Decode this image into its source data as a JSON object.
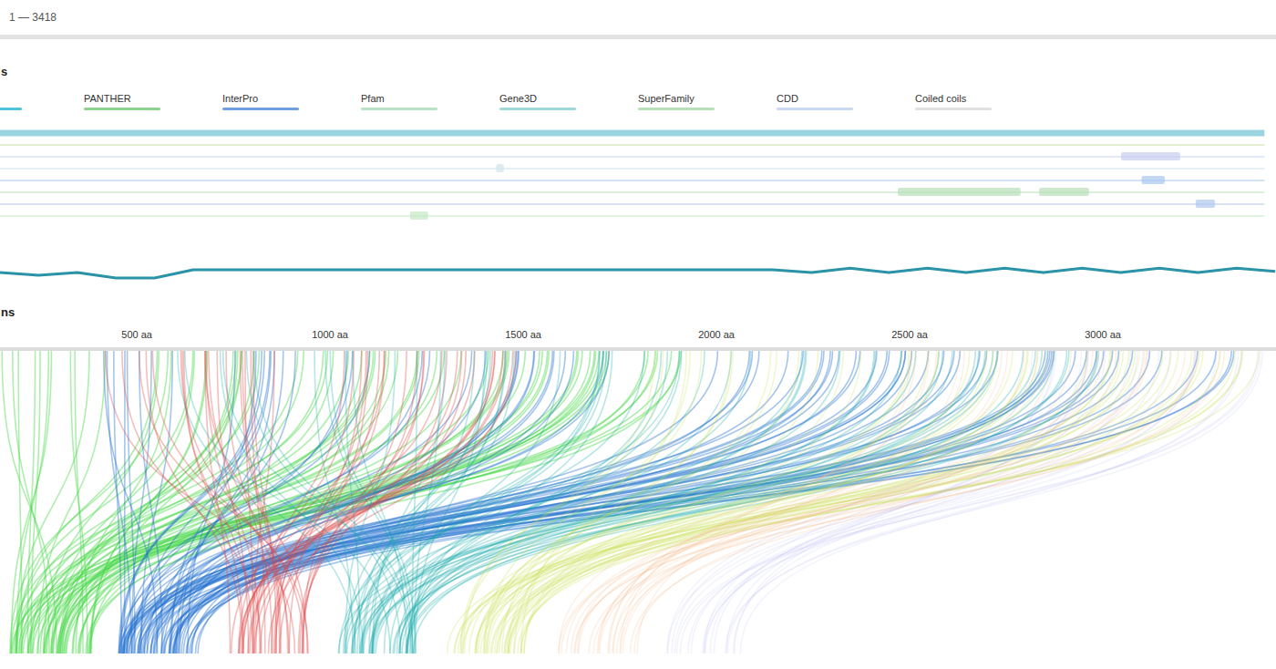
{
  "header": {
    "range": "1 — 3418"
  },
  "domains": {
    "title": "s",
    "legend": [
      {
        "label": "",
        "color": "#4fc3d9"
      },
      {
        "label": "PANTHER",
        "color": "#8fd18f"
      },
      {
        "label": "InterPro",
        "color": "#6f9fe0"
      },
      {
        "label": "Pfam",
        "color": "#b9e3c4"
      },
      {
        "label": "Gene3D",
        "color": "#9ed8d8"
      },
      {
        "label": "SuperFamily",
        "color": "#b8e0b8"
      },
      {
        "label": "CDD",
        "color": "#c8d8f5"
      },
      {
        "label": "Coiled coils",
        "color": "#e0e0e0"
      }
    ],
    "tracks": [
      {
        "kind": "main",
        "color": "#8fd0dc",
        "segments": []
      },
      {
        "kind": "minor",
        "color": "#c8dca0",
        "segments": []
      },
      {
        "kind": "minor",
        "color": "#c8cff0",
        "segments": [
          {
            "start": 3047,
            "end": 3200
          }
        ]
      },
      {
        "kind": "minor",
        "color": "#d0e4ec",
        "segments": [
          {
            "start": 1430,
            "end": 1450
          }
        ]
      },
      {
        "kind": "minor",
        "color": "#a8c8ec",
        "segments": [
          {
            "start": 3100,
            "end": 3160
          }
        ]
      },
      {
        "kind": "minor",
        "color": "#b8e0b8",
        "segments": [
          {
            "start": 2469,
            "end": 2787
          },
          {
            "start": 2835,
            "end": 2964
          }
        ]
      },
      {
        "kind": "minor",
        "color": "#b0c8f0",
        "segments": [
          {
            "start": 3240,
            "end": 3290
          }
        ]
      },
      {
        "kind": "minor",
        "color": "#c4e8c4",
        "segments": [
          {
            "start": 1207,
            "end": 1254
          }
        ]
      }
    ],
    "profile": [
      3,
      2.5,
      3,
      2,
      2,
      3.5,
      3.5,
      3.5,
      3.5,
      3.5,
      3.5,
      3.5,
      3.5,
      3.5,
      3.5,
      3.5,
      3.5,
      3.5,
      3.5,
      3.5,
      3.5,
      3,
      3.8,
      3,
      3.8,
      3,
      3.8,
      3,
      3.8,
      3,
      3.8,
      3,
      3.8,
      3.2
    ]
  },
  "positions": {
    "title": "ns",
    "ticks": [
      {
        "label": "500 aa",
        "value": 500
      },
      {
        "label": "1000 aa",
        "value": 1000
      },
      {
        "label": "1500 aa",
        "value": 1500
      },
      {
        "label": "2000 aa",
        "value": 2000
      },
      {
        "label": "2500 aa",
        "value": 2500
      },
      {
        "label": "3000 aa",
        "value": 3000
      }
    ],
    "groups": [
      {
        "color": "#4cd94c",
        "start": 146,
        "end": 2000,
        "links": 70
      },
      {
        "color": "#1f6fd0",
        "start": 300,
        "end": 3418,
        "links": 80
      },
      {
        "color": "#e04848",
        "start": 400,
        "end": 1500,
        "links": 45
      },
      {
        "color": "#14a8a8",
        "start": 600,
        "end": 3000,
        "links": 60
      },
      {
        "color": "#c6e04a",
        "start": 1800,
        "end": 3418,
        "links": 45
      },
      {
        "color": "#f5b888",
        "start": 2500,
        "end": 3400,
        "links": 25
      },
      {
        "color": "#b0b0f0",
        "start": 2800,
        "end": 3418,
        "links": 20
      }
    ]
  }
}
